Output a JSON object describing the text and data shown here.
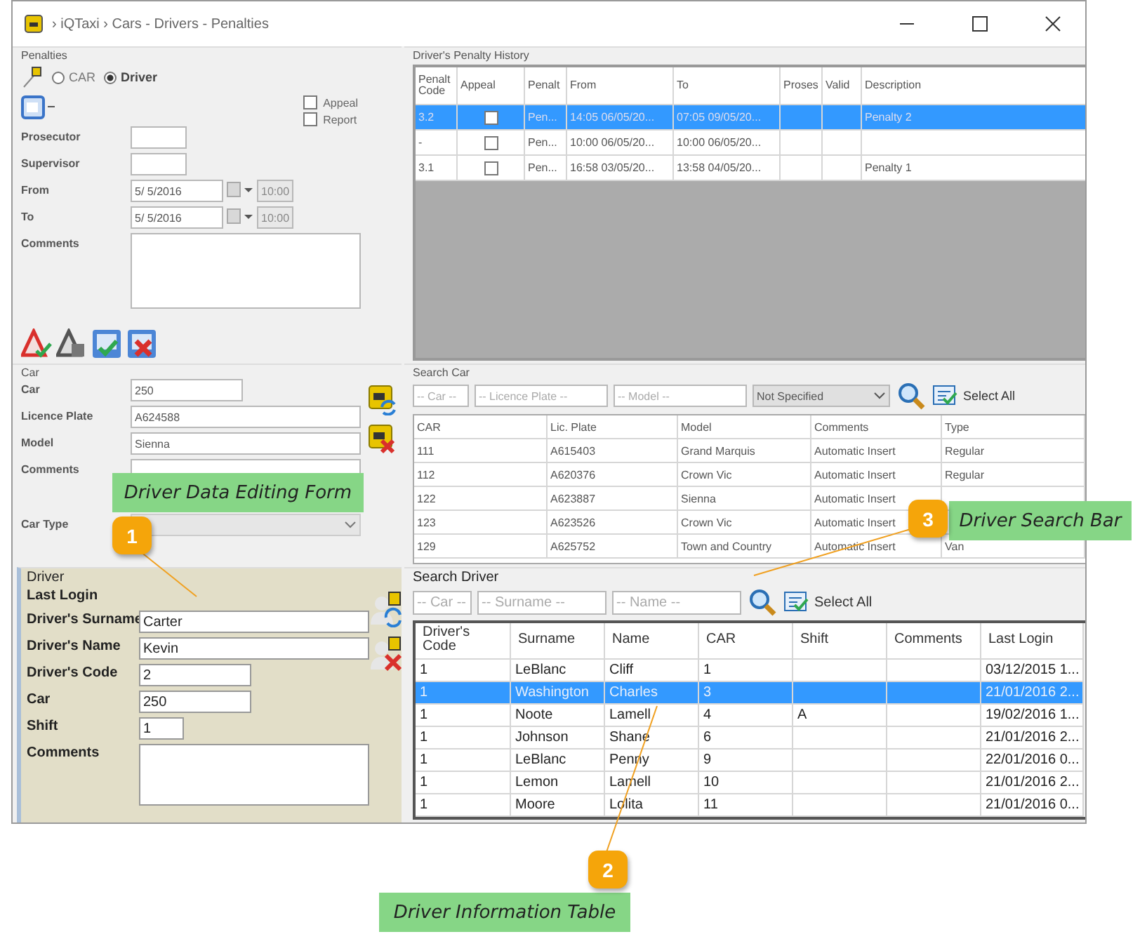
{
  "window": {
    "title": "› iQTaxi › Cars - Drivers - Penalties"
  },
  "penalties": {
    "title": "Penalties",
    "targets": [
      {
        "label": "CAR",
        "selected": false
      },
      {
        "label": "Driver",
        "selected": true
      }
    ],
    "checkboxes": [
      {
        "label": "Appeal",
        "checked": false
      },
      {
        "label": "Report",
        "checked": false
      }
    ],
    "fields": [
      {
        "label": "Prosecutor",
        "kind": "short"
      },
      {
        "label": "Supervisor",
        "kind": "short"
      },
      {
        "label": "From",
        "kind": "datetime",
        "value": "5/ 5/2016",
        "time": "10:00"
      },
      {
        "label": "To",
        "kind": "datetime",
        "value": "5/ 5/2016",
        "time": "10:00"
      },
      {
        "label": "Comments",
        "kind": "textarea"
      }
    ]
  },
  "car": {
    "title": "Car",
    "fields": [
      {
        "label": "Car",
        "kind": "short",
        "value": "250"
      },
      {
        "label": "Licence Plate",
        "kind": "text",
        "value": "A624588"
      },
      {
        "label": "Model",
        "kind": "text",
        "value": "Sienna"
      },
      {
        "label": "Comments",
        "kind": "textarea"
      },
      {
        "label": "Car Type",
        "kind": "select",
        "disabled": true
      }
    ]
  },
  "driver": {
    "title": "Driver",
    "fields": [
      {
        "label": "Last Login",
        "kind": "none"
      },
      {
        "label": "Driver's Surname",
        "kind": "text",
        "value": "Carter"
      },
      {
        "label": "Driver's Name",
        "kind": "text",
        "value": "Kevin"
      },
      {
        "label": "Driver's Code",
        "kind": "short",
        "value": "2"
      },
      {
        "label": "Car",
        "kind": "short",
        "value": "250"
      },
      {
        "label": "Shift",
        "kind": "tiny",
        "value": "1"
      },
      {
        "label": "Comments",
        "kind": "textarea"
      }
    ]
  },
  "penalty_history": {
    "title": "Driver's Penalty History",
    "columns": [
      "Penalt Code",
      "Appeal",
      "Penalt",
      "From",
      "To",
      "Proses",
      "Valid",
      "Description"
    ],
    "rows": [
      {
        "code": "3.2",
        "appeal": false,
        "penalty": "Pen...",
        "from": "14:05 06/05/20...",
        "to": "07:05 09/05/20...",
        "description": "Penalty 2",
        "selected": true
      },
      {
        "code": "-",
        "appeal": false,
        "penalty": "Pen...",
        "from": "10:00 06/05/20...",
        "to": "10:00 06/05/20...",
        "selected": false
      },
      {
        "code": "3.1",
        "appeal": false,
        "penalty": "Pen...",
        "from": "16:58 03/05/20...",
        "to": "13:58 04/05/20...",
        "description": "Penalty 1",
        "selected": false
      }
    ]
  },
  "search_car": {
    "title": "Search Car",
    "car_placeholder": "-- Car --",
    "plate_placeholder": "-- Licence Plate --",
    "model_placeholder": "-- Model --",
    "type_value": "Not Specified",
    "select_all": "Select All",
    "columns": [
      "CAR",
      "Lic. Plate",
      "Model",
      "Comments",
      "Type"
    ],
    "rows": [
      [
        "111",
        "A615403",
        "Grand Marquis",
        "Automatic Insert",
        "Regular"
      ],
      [
        "112",
        "A620376",
        "Crown Vic",
        "Automatic Insert",
        "Regular"
      ],
      [
        "122",
        "A623887",
        "Sienna",
        "Automatic Insert"
      ],
      [
        "123",
        "A623526",
        "Crown Vic",
        "Automatic Insert"
      ],
      [
        "129",
        "A625752",
        "Town and Country",
        "Automatic Insert",
        "Van"
      ]
    ]
  },
  "search_driver": {
    "title": "Search Driver",
    "car_placeholder": "-- Car --",
    "surname_placeholder": "-- Surname --",
    "name_placeholder": "-- Name --",
    "select_all": "Select All",
    "columns": [
      "Driver's Code",
      "Surname",
      "Name",
      "CAR",
      "Shift",
      "Comments",
      "Last Login"
    ],
    "rows": [
      {
        "cells": [
          "1",
          "LeBlanc",
          "Cliff",
          "1",
          "",
          "",
          "03/12/2015 1..."
        ],
        "selected": false
      },
      {
        "cells": [
          "1",
          "Washington",
          "Charles",
          "3",
          "",
          "",
          "21/01/2016 2..."
        ],
        "selected": true
      },
      {
        "cells": [
          "1",
          "Noote",
          "Lamell",
          "4",
          "A",
          "",
          "19/02/2016 1..."
        ],
        "selected": false
      },
      {
        "cells": [
          "1",
          "Johnson",
          "Shane",
          "6",
          "",
          "",
          "21/01/2016 2..."
        ],
        "selected": false
      },
      {
        "cells": [
          "1",
          "LeBlanc",
          "Penny",
          "9",
          "",
          "",
          "22/01/2016 0..."
        ],
        "selected": false
      },
      {
        "cells": [
          "1",
          "Lemon",
          "Lamell",
          "10",
          "",
          "",
          "21/01/2016 2..."
        ],
        "selected": false
      },
      {
        "cells": [
          "1",
          "Moore",
          "Lolita",
          "11",
          "",
          "",
          "21/01/2016 0..."
        ],
        "selected": false
      }
    ]
  },
  "callouts": [
    {
      "number": "1",
      "label": "Driver Data Editing Form"
    },
    {
      "number": "2",
      "label": "Driver Information Table"
    },
    {
      "number": "3",
      "label": "Driver Search Bar"
    }
  ]
}
